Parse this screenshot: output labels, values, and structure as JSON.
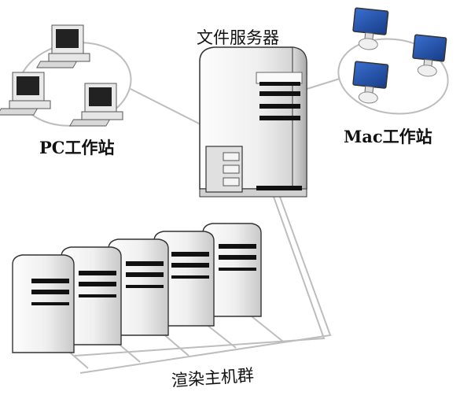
{
  "labels": {
    "file_server": "文件服务器",
    "pc_workstation": "PC工作站",
    "mac_workstation": "Mac工作站",
    "render_farm": "渲染主机群"
  },
  "colors": {
    "line": "#b8b8b8",
    "case_light": "#f4f4f4",
    "case_shadow": "#c8c8c8",
    "slot": "#1a1a1a",
    "mac_screen": "#1f4fa8",
    "pc_screen": "#222222"
  },
  "icons": {
    "pc": "desktop-pc-icon",
    "mac": "mac-monitor-icon",
    "server": "tower-server-icon"
  }
}
